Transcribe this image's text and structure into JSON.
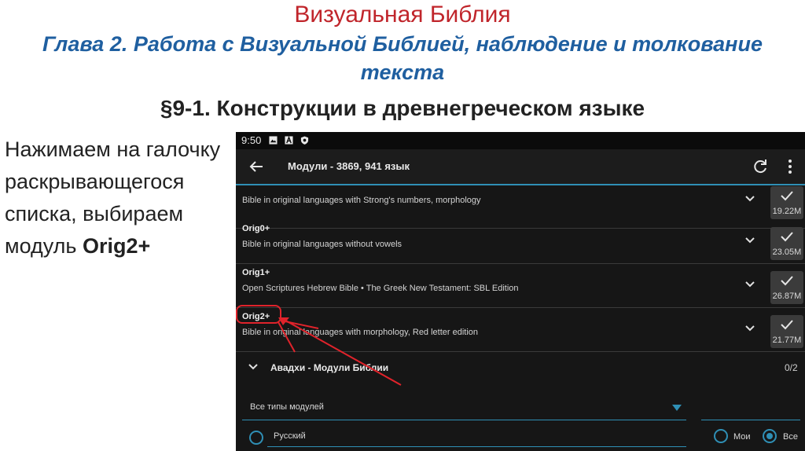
{
  "slide": {
    "title": "Визуальная Библия",
    "subtitle": "Глава 2. Работа с Визуальной Библией, наблюдение и толкование текста",
    "section_heading": "§9-1. Конструкции в древнегреческом языке",
    "instruction_lead": "Нажимаем на галочку раскрывающегося списка, выбираем модуль ",
    "instruction_bold": "Orig2+"
  },
  "status_bar": {
    "time": "9:50"
  },
  "app_bar": {
    "title": "Модули - 3869, 941 язык"
  },
  "modules": [
    {
      "code": "",
      "description": "Bible in original languages with Strong's numbers, morphology",
      "size": "19.22M"
    },
    {
      "code": "Orig0+",
      "description": "Bible in original languages without vowels",
      "size": "23.05M"
    },
    {
      "code": "Orig1+",
      "description": "Open Scriptures Hebrew Bible • The Greek New Testament: SBL Edition",
      "size": "26.87M"
    },
    {
      "code": "Orig2+",
      "description": "Bible in original languages with morphology, Red letter edition",
      "size": "21.77M"
    }
  ],
  "group": {
    "title": "Авадхи - Модули Библии",
    "count": "0/2"
  },
  "filters": {
    "module_type": "Все типы модулей",
    "language": "Русский",
    "radio_mine": "Мои",
    "radio_all": "Все"
  },
  "colors": {
    "accent": "#2f8fb5",
    "highlight": "#e0232b",
    "title": "#c0252b",
    "subtitle": "#1f5fa0"
  }
}
